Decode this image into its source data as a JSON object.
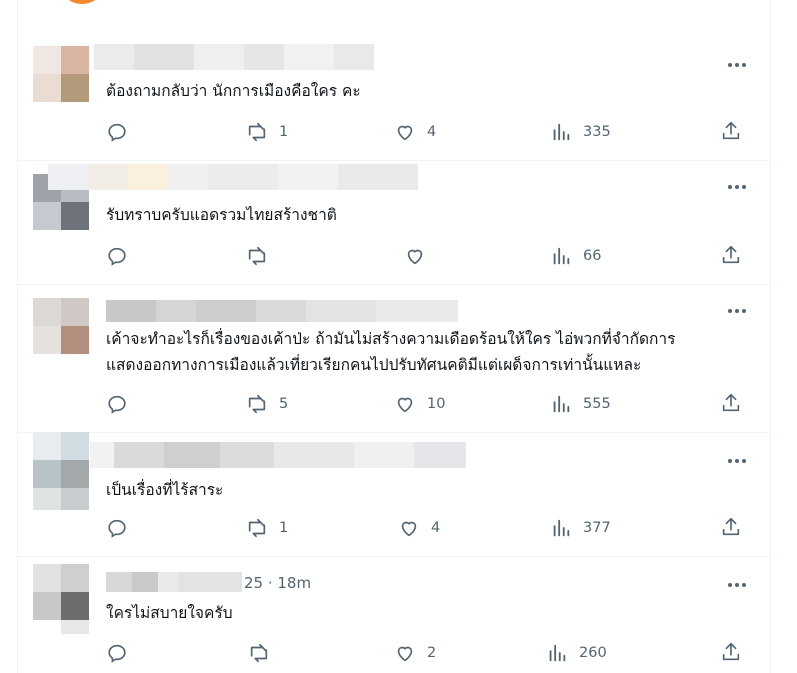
{
  "replies": [
    {
      "text_lines": [
        "ต้องถามกลับว่า นักการเมืองคือใคร คะ"
      ],
      "meta_tail": "",
      "replies": "",
      "reposts": "1",
      "likes": "4",
      "views": "335"
    },
    {
      "text_lines": [
        "รับทราบครับแอดรวมไทยสร้างชาติ"
      ],
      "meta_tail": "",
      "replies": "",
      "reposts": "",
      "likes": "",
      "views": "66"
    },
    {
      "text_lines": [
        "เค้าจะทำอะไรก็เรื่องของเค้าป่ะ ถ้ามันไม่สร้างความเดือดร้อนให้ใคร ไอ่พวกที่จำกัดการ",
        "แสดงออกทางการเมืองแล้วเที่ยวเรียกคนไปปรับทัศนคติมีแต่เผด็จการเท่านั้นแหละ"
      ],
      "meta_tail": "",
      "replies": "",
      "reposts": "5",
      "likes": "10",
      "views": "555"
    },
    {
      "text_lines": [
        "เป็นเรื่องที่ไร้สาระ"
      ],
      "meta_tail": "",
      "replies": "",
      "reposts": "1",
      "likes": "4",
      "views": "377"
    },
    {
      "text_lines": [
        "ใครไม่สบายใจครับ"
      ],
      "meta_tail": "25 · 18m",
      "replies": "",
      "reposts": "",
      "likes": "2",
      "views": "260"
    }
  ],
  "icons": {
    "reply": "reply-icon",
    "repost": "repost-icon",
    "like": "like-icon",
    "views": "views-icon",
    "share": "share-icon",
    "more": "more-icon"
  },
  "colors": {
    "muted": "#536471",
    "text": "#0f1419",
    "border": "#eff3f4"
  }
}
